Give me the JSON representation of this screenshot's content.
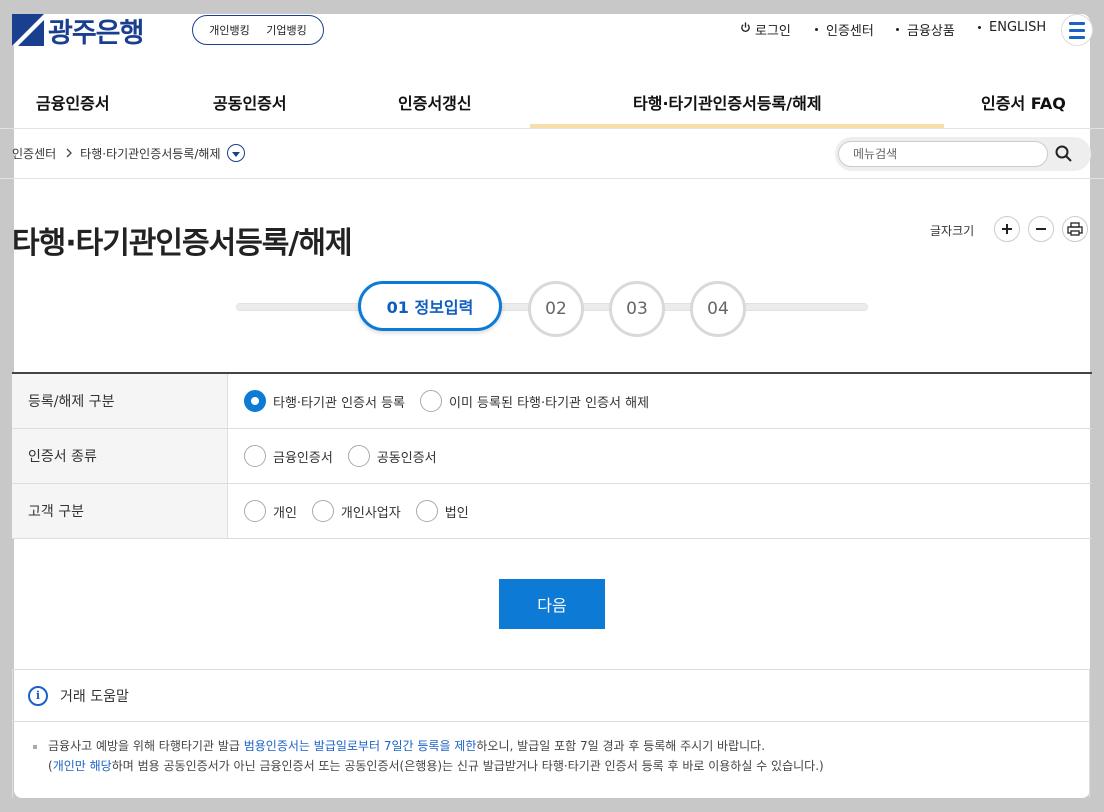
{
  "header": {
    "logo_text": "광주은행",
    "bank_tabs": [
      "개인뱅킹",
      "기업뱅킹"
    ],
    "utils": {
      "login": "로그인",
      "cert_center": "인증센터",
      "products": "금융상품",
      "english": "ENGLISH"
    }
  },
  "gnb": [
    "금융인증서",
    "공동인증서",
    "인증서갱신",
    "타행·타기관인증서등록/해제",
    "인증서 FAQ"
  ],
  "breadcrumb": {
    "home": "인증센터",
    "current": "타행·타기관인증서등록/해제"
  },
  "search": {
    "placeholder": "메뉴검색"
  },
  "page": {
    "title": "타행·타기관인증서등록/해제",
    "font_size_label": "글자크기"
  },
  "steps": {
    "active": "01 정보입력",
    "others": [
      "02",
      "03",
      "04"
    ]
  },
  "form": {
    "rows": [
      {
        "label": "등록/해제 구분",
        "options": [
          "타행·타기관 인증서 등록",
          "이미 등록된 타행·타기관 인증서 해제"
        ],
        "selected": 0
      },
      {
        "label": "인증서 종류",
        "options": [
          "금융인증서",
          "공동인증서"
        ],
        "selected": null
      },
      {
        "label": "고객 구분",
        "options": [
          "개인",
          "개인사업자",
          "법인"
        ],
        "selected": null
      }
    ],
    "next_label": "다음"
  },
  "help": {
    "title": "거래 도움말",
    "line1_a": "금융사고 예방을 위해 타행타기관 발급 ",
    "line1_b": "범용인증서는 발급일로부터 7일간 등록을 제한",
    "line1_c": "하오니, 발급일 포함 7일 경과 후 등록해 주시기 바랍니다.",
    "line2_a": "(",
    "line2_b": "개인만 해당",
    "line2_c": "하며 범용 공동인증서가 아닌 금융인증서 또는 공동인증서(은행용)는 신규 발급받거나 타행·타기관 인증서 등록 후 바로 이용하실 수 있습니다.)"
  },
  "colors": {
    "brand": "#1b3f8f",
    "accent": "#0d7bd6",
    "active_tab_bar": "#f7dfab"
  }
}
